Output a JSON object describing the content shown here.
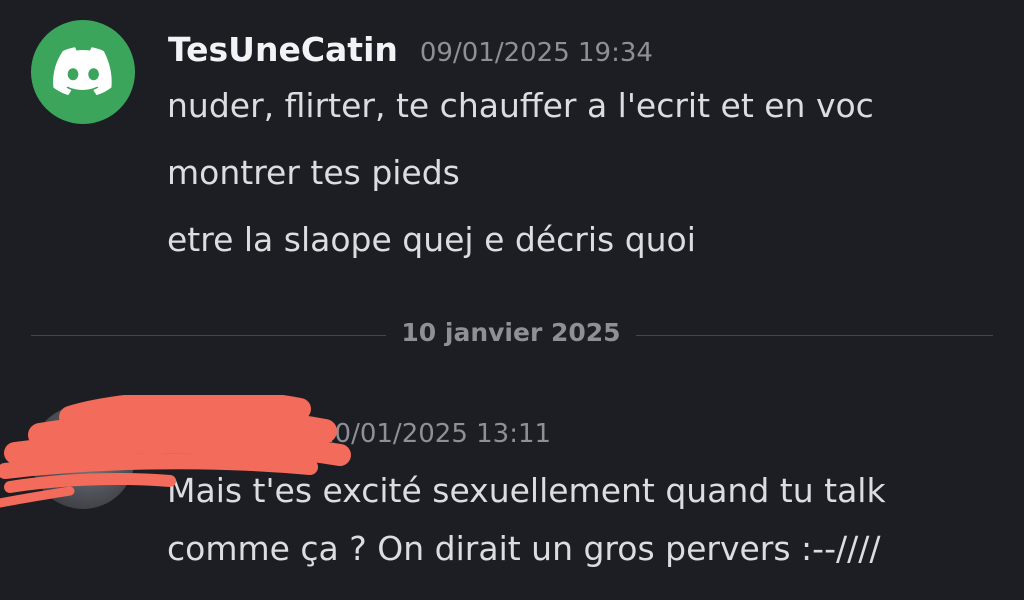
{
  "messages": [
    {
      "author": "TesUneCatin",
      "timestamp": "09/01/2025 19:34",
      "avatar_icon": "discord-logo-icon",
      "lines": [
        "nuder, flirter, te chauffer a l'ecrit et en voc",
        "montrer tes pieds",
        "etre la slaope quej e décris quoi"
      ]
    },
    {
      "author": "",
      "timestamp": "10/01/2025 13:11",
      "avatar_icon": "user-avatar",
      "lines": [
        "Mais t'es excité sexuellement quand tu talk",
        "comme ça ? On dirait un gros pervers :--////"
      ]
    }
  ],
  "date_divider": "10 janvier 2025",
  "colors": {
    "background": "#1d1e23",
    "discord_green": "#3ba55c",
    "redaction": "#f26b5b",
    "text": "#dcdde1",
    "muted": "#8e9097"
  }
}
